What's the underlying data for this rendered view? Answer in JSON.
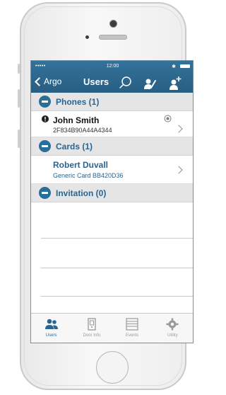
{
  "status_bar": {
    "signal": "•••••",
    "time": "12:00",
    "bluetooth": "✱"
  },
  "nav": {
    "back_label": "Argo",
    "title": "Users",
    "search_icon": "search-icon",
    "edit_user_icon": "user-edit-icon",
    "add_user_icon": "user-add-icon"
  },
  "sections": {
    "phones": {
      "title": "Phones (1)",
      "items": [
        {
          "name": "John Smith",
          "subtitle": "2F834B90A44A4344",
          "status_icon": "info-badge-icon",
          "trailing_icon": "signal-icon"
        }
      ]
    },
    "cards": {
      "title": "Cards (1)",
      "items": [
        {
          "name": "Robert Duvall",
          "subtitle": "Generic Card BB420D36"
        }
      ]
    },
    "invitation": {
      "title": "Invitation (0)",
      "items": []
    }
  },
  "tabbar": {
    "tabs": [
      {
        "label": "Users",
        "icon": "users-icon",
        "active": true
      },
      {
        "label": "Door Info",
        "icon": "door-icon",
        "active": false
      },
      {
        "label": "Events",
        "icon": "list-icon",
        "active": false
      },
      {
        "label": "Utility",
        "icon": "gear-icon",
        "active": false
      }
    ]
  },
  "colors": {
    "header": "#2f6a91",
    "section_title": "#2a6591",
    "card_text": "#2a6591",
    "active_tab": "#2a6591",
    "inactive_tab": "#9a9a9e"
  }
}
